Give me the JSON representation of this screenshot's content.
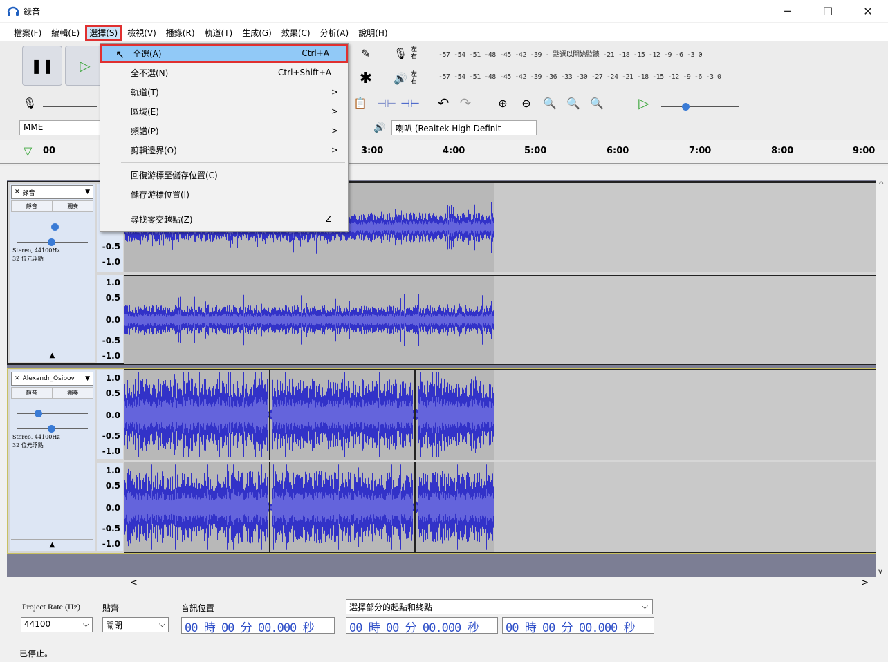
{
  "window": {
    "title": "錄音",
    "buttons": [
      "─",
      "☐",
      "✕"
    ]
  },
  "menubar": [
    {
      "label": "檔案(F)"
    },
    {
      "label": "編輯(E)"
    },
    {
      "label": "選擇(S)",
      "highlighted": true
    },
    {
      "label": "檢視(V)"
    },
    {
      "label": "播錄(R)"
    },
    {
      "label": "軌道(T)"
    },
    {
      "label": "生成(G)"
    },
    {
      "label": "效果(C)"
    },
    {
      "label": "分析(A)"
    },
    {
      "label": "說明(H)"
    }
  ],
  "select_menu": {
    "items": [
      {
        "label": "全選(A)",
        "shortcut": "Ctrl+A",
        "active": true
      },
      {
        "label": "全不選(N)",
        "shortcut": "Ctrl+Shift+A"
      },
      {
        "label": "軌道(T)",
        "submenu": ">"
      },
      {
        "label": "區域(E)",
        "submenu": ">"
      },
      {
        "label": "頻譜(P)",
        "submenu": ">"
      },
      {
        "label": "剪輯邊界(O)",
        "submenu": ">"
      },
      {
        "label": "回復游標至儲存位置(C)"
      },
      {
        "label": "儲存游標位置(I)"
      },
      {
        "label": "尋找零交越點(Z)",
        "shortcut": "Z"
      }
    ]
  },
  "toolbar": {
    "meter_rec": "-57 -54 -51 -48 -45 -42 -39 - 點選以開始監聽 -21 -18 -15 -12 -9 -6 -3 0",
    "meter_play": "-57 -54 -51 -48 -45 -42 -39 -36 -33 -30 -27 -24 -21 -18 -15 -12 -9 -6 -3 0",
    "host": "MME",
    "output_device": "喇叭 (Realtek High Definit",
    "lr_label": "左右"
  },
  "ruler": {
    "labels": [
      {
        "t": "00"
      },
      {
        "t": "3:00"
      },
      {
        "t": "4:00"
      },
      {
        "t": "5:00"
      },
      {
        "t": "6:00"
      },
      {
        "t": "7:00"
      },
      {
        "t": "8:00"
      },
      {
        "t": "9:00"
      }
    ]
  },
  "tracks": [
    {
      "name": "錄音",
      "mute": "靜音",
      "solo": "獨奏",
      "info": [
        "Stereo, 44100Hz",
        "32 位元浮點"
      ],
      "scale_top": [
        "-0.5",
        "-1.0"
      ],
      "scale_bottom": [
        "1.0",
        "0.5",
        "0.0",
        "-0.5",
        "-1.0"
      ],
      "gain": 0.5,
      "pan": 0.5
    },
    {
      "name": "Alexandr_Osipov",
      "mute": "靜音",
      "solo": "獨奏",
      "info": [
        "Stereo, 44100Hz",
        "32 位元浮點"
      ],
      "scale_top": [
        "1.0",
        "0.5",
        "0.0",
        "-0.5",
        "-1.0"
      ],
      "scale_bottom": [
        "1.0",
        "0.5",
        "0.0",
        "-0.5",
        "-1.0"
      ],
      "gain": 0.3,
      "pan": 0.5
    }
  ],
  "selection_toolbar": {
    "project_rate_label": "Project Rate (Hz)",
    "project_rate": "44100",
    "snap_label": "貼齊",
    "snap_value": "關閉",
    "position_label": "音訊位置",
    "selection_label": "選擇部分的起點和終點",
    "position_time": "00 時 00 分 00.000 秒",
    "start_time": "00 時 00 分 00.000 秒",
    "end_time": "00 時 00 分 00.000 秒"
  },
  "status": "已停止。",
  "colors": {
    "wave": "#3232c8",
    "wave_rms": "#6464dc",
    "highlight": "#e03030"
  }
}
